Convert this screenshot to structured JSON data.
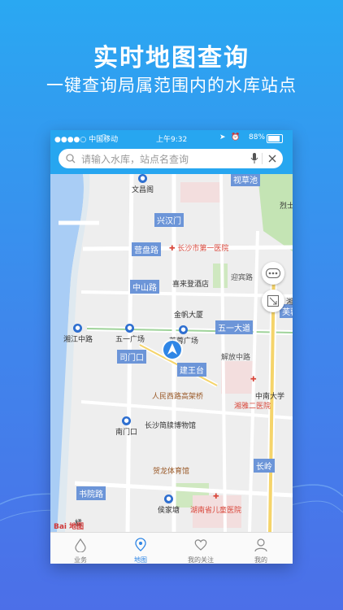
{
  "promo": {
    "headline": "实时地图查询",
    "subline": "一键查询局属范围内的水库站点"
  },
  "statusbar": {
    "carrier": "●●●●○ 中国移动",
    "time": "上午9:32",
    "battery": "88%"
  },
  "search": {
    "placeholder": "请输入水库，站点名查询"
  },
  "map": {
    "roads": [
      "兴汉门",
      "营盘路",
      "中山路",
      "五一大道",
      "司门口",
      "建王台",
      "书院路",
      "长岭",
      "迎宾路",
      "芙蓉",
      "解放中路"
    ],
    "places": [
      "文昌阁",
      "喜来登酒店",
      "金帆大厦",
      "湘江中路",
      "五一广场",
      "芙蓉广场",
      "南门口",
      "长沙简牍博物馆",
      "侯家塘",
      "烈士",
      "湘",
      "橘",
      "中南大学"
    ],
    "red_places": [
      "长沙市第一医院",
      "湘雅二医院",
      "湖南省儿童医院"
    ],
    "brown_places": [
      "人民西路高架桥",
      "贺龙体育馆"
    ],
    "park_label": "视草池",
    "logo": "Bai 地图"
  },
  "tabs": [
    {
      "label": "业务",
      "icon": "water-drop-icon"
    },
    {
      "label": "地图",
      "icon": "map-pin-icon",
      "active": true
    },
    {
      "label": "我的关注",
      "icon": "heart-icon"
    },
    {
      "label": "我的",
      "icon": "user-icon"
    }
  ],
  "colors": {
    "accent": "#27a6f0",
    "active_tab": "#2f86e6",
    "road_label": "#6c95d8"
  }
}
